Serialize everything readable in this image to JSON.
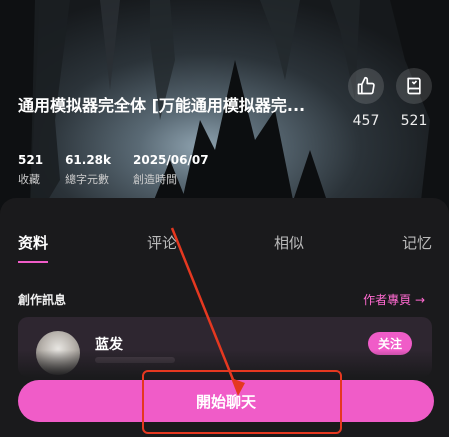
{
  "hero": {
    "title": "通用模拟器完全体 [万能通用模拟器完...",
    "like_count": "457",
    "bookmark_count": "521",
    "stats": [
      {
        "value": "521",
        "label": "收藏"
      },
      {
        "value": "61.28k",
        "label": "總字元數"
      },
      {
        "value": "2025/06/07",
        "label": "創造時間"
      }
    ]
  },
  "tabs": [
    {
      "label": "资料",
      "active": true
    },
    {
      "label": "评论",
      "active": false
    },
    {
      "label": "相似",
      "active": false
    },
    {
      "label": "记忆",
      "active": false
    }
  ],
  "info": {
    "section_title": "創作訊息",
    "author_link": "作者專頁 →"
  },
  "author": {
    "name": "蓝发",
    "follow_label": "关注"
  },
  "start_chat_label": "開始聊天",
  "colors": {
    "accent": "#f05cc8",
    "annotation": "#e53820"
  }
}
